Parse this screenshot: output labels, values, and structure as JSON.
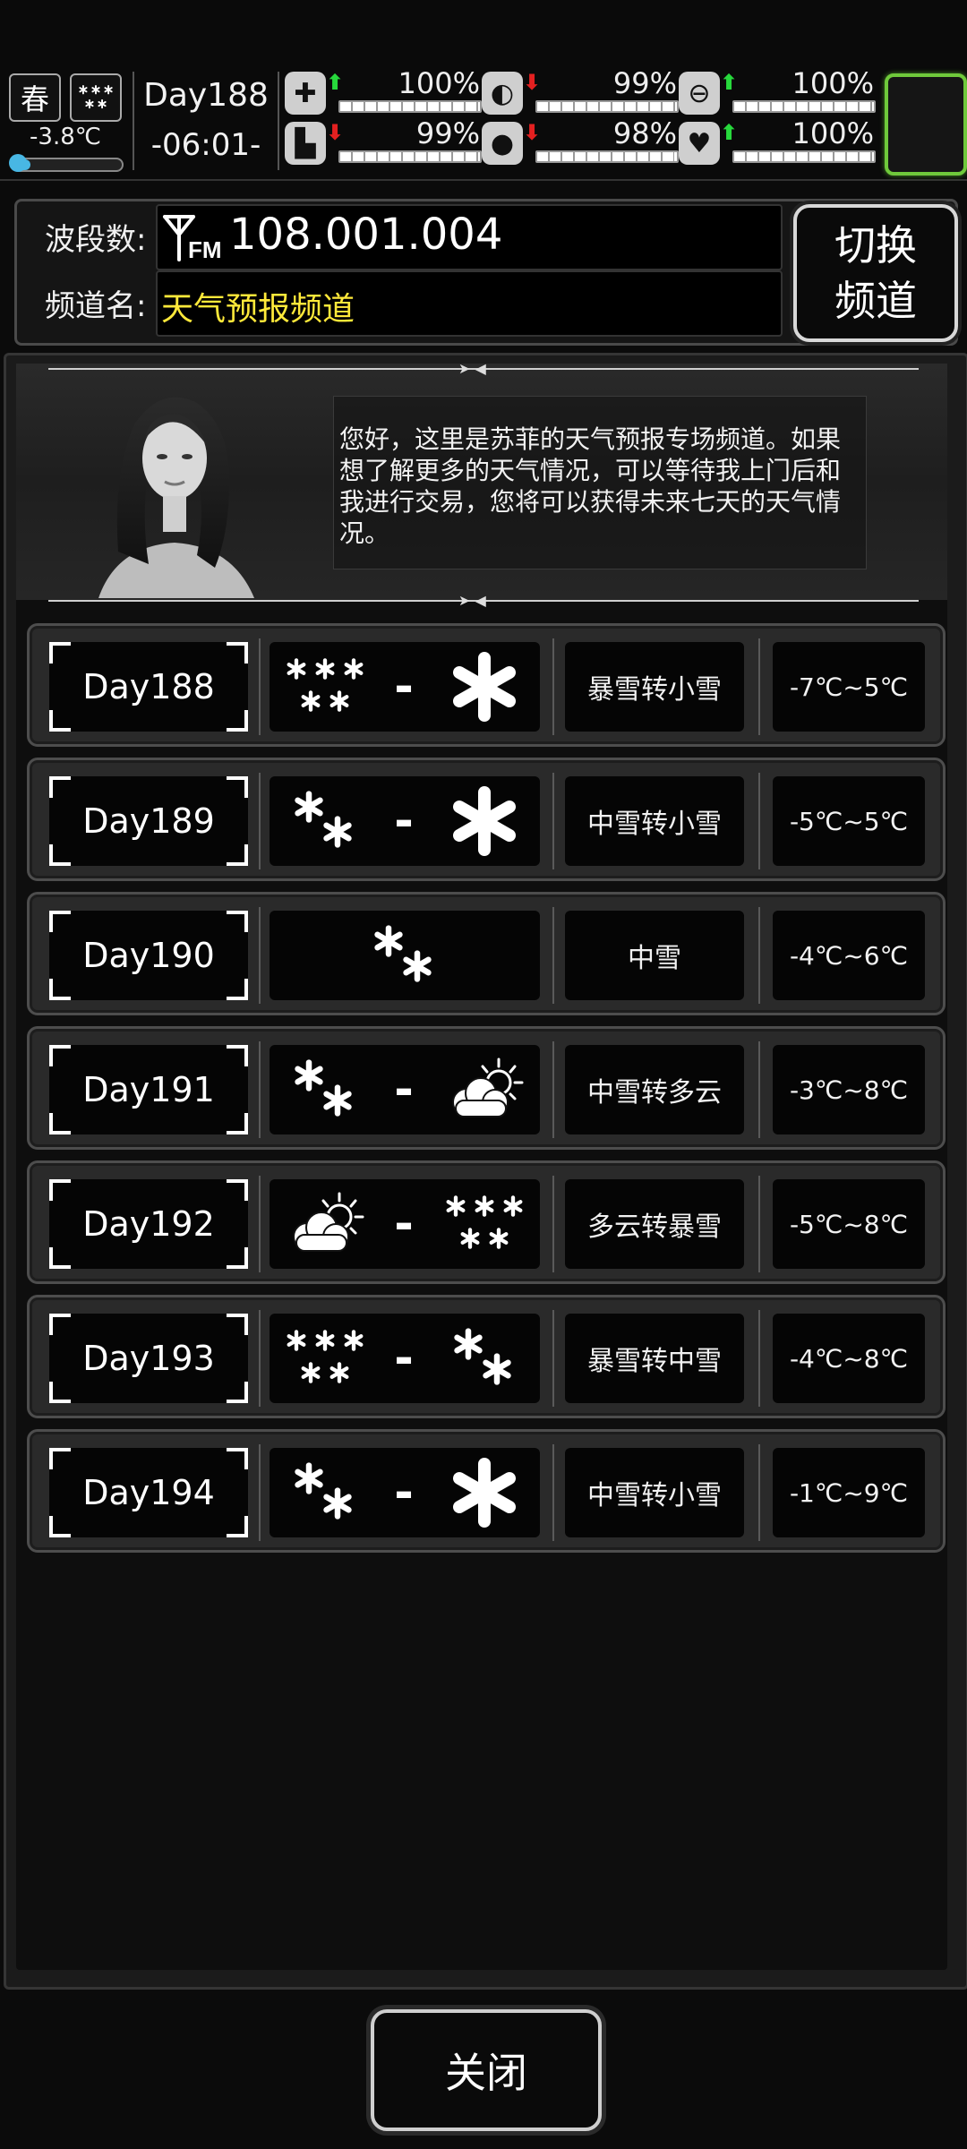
{
  "hud": {
    "season": "春",
    "weather_icon": "snow-heavy-icon",
    "temperature": "-3.8℃",
    "day": "Day188",
    "time": "-06:01-",
    "stats": [
      {
        "icon": "medkit-icon",
        "trend": "up",
        "value": "100%",
        "level": 1.0
      },
      {
        "icon": "stomach-icon",
        "trend": "down",
        "value": "99%",
        "level": 0.99
      },
      {
        "icon": "hygiene-icon",
        "trend": "up",
        "value": "100%",
        "level": 1.0
      },
      {
        "icon": "foot-icon",
        "trend": "down",
        "value": "99%",
        "level": 0.99
      },
      {
        "icon": "water-drop-icon",
        "trend": "down",
        "value": "98%",
        "level": 0.98
      },
      {
        "icon": "heart-icon",
        "trend": "up",
        "value": "100%",
        "level": 1.0
      }
    ],
    "accent_green": "#6fc93b",
    "arrow_up_color": "#27d93c",
    "arrow_down_color": "#e32020"
  },
  "radio": {
    "band_label": "波段数:",
    "band_icon": "fm-antenna-icon",
    "band_value": "108.001.004",
    "channel_label": "频道名:",
    "channel_value": "天气预报频道",
    "channel_color": "#ffe93a",
    "switch_label_1": "切换",
    "switch_label_2": "频道"
  },
  "intro": {
    "portrait": "host-portrait",
    "text": "您好，这里是苏菲的天气预报专场频道。如果想了解更多的天气情况，可以等待我上门后和我进行交易，您将可以获得未来七天的天气情况。"
  },
  "forecast": [
    {
      "day": "Day188",
      "icons": [
        "snow-heavy-icon",
        "snowflake-icon"
      ],
      "desc": "暴雪转小雪",
      "temp": "-7℃~5℃"
    },
    {
      "day": "Day189",
      "icons": [
        "snow-medium-icon",
        "snowflake-icon"
      ],
      "desc": "中雪转小雪",
      "temp": "-5℃~5℃"
    },
    {
      "day": "Day190",
      "icons": [
        "snow-medium-icon"
      ],
      "desc": "中雪",
      "temp": "-4℃~6℃"
    },
    {
      "day": "Day191",
      "icons": [
        "snow-medium-icon",
        "partly-cloudy-icon"
      ],
      "desc": "中雪转多云",
      "temp": "-3℃~8℃"
    },
    {
      "day": "Day192",
      "icons": [
        "partly-cloudy-icon",
        "snow-heavy-icon"
      ],
      "desc": "多云转暴雪",
      "temp": "-5℃~8℃"
    },
    {
      "day": "Day193",
      "icons": [
        "snow-heavy-icon",
        "snow-medium-icon"
      ],
      "desc": "暴雪转中雪",
      "temp": "-4℃~8℃"
    },
    {
      "day": "Day194",
      "icons": [
        "snow-medium-icon",
        "snowflake-icon"
      ],
      "desc": "中雪转小雪",
      "temp": "-1℃~9℃"
    }
  ],
  "icon_separator": "-",
  "close_label": "关闭"
}
